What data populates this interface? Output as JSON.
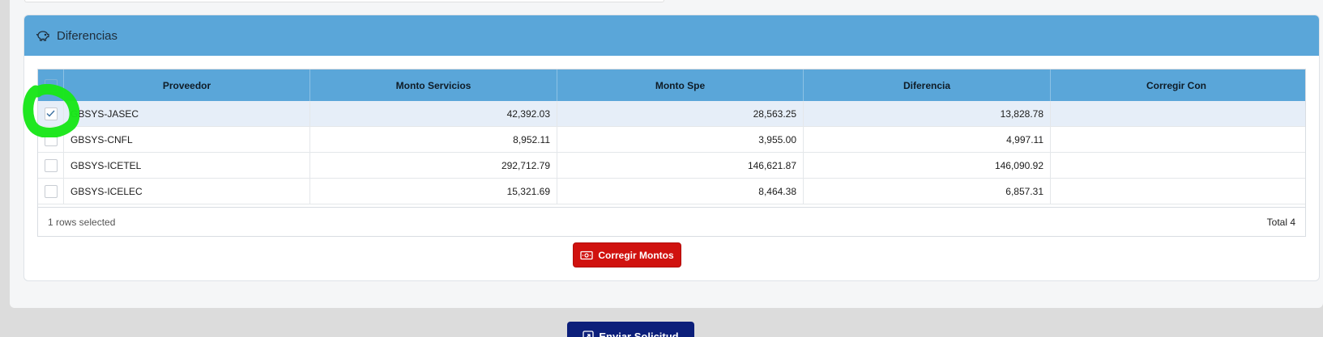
{
  "panel": {
    "title": "Diferencias",
    "title_icon": "piggy-bank-icon",
    "header_color": "#5aa6d9"
  },
  "table": {
    "columns": [
      "Proveedor",
      "Monto Servicios",
      "Monto Spe",
      "Diferencia",
      "Corregir Con"
    ],
    "rows": [
      {
        "proveedor": "GBSYS-JASEC",
        "monto_servicios": "42,392.03",
        "monto_spe": "28,563.25",
        "diferencia": "13,828.78",
        "corregir_con": "",
        "selected": true
      },
      {
        "proveedor": "GBSYS-CNFL",
        "monto_servicios": "8,952.11",
        "monto_spe": "3,955.00",
        "diferencia": "4,997.11",
        "corregir_con": "",
        "selected": false
      },
      {
        "proveedor": "GBSYS-ICETEL",
        "monto_servicios": "292,712.79",
        "monto_spe": "146,621.87",
        "diferencia": "146,090.92",
        "corregir_con": "",
        "selected": false
      },
      {
        "proveedor": "GBSYS-ICELEC",
        "monto_servicios": "15,321.69",
        "monto_spe": "8,464.38",
        "diferencia": "6,857.31",
        "corregir_con": "",
        "selected": false
      }
    ],
    "selection_status": "1 rows selected",
    "total_label": "Total 4"
  },
  "buttons": {
    "corregir_montos": "Corregir Montos",
    "corregir_icon": "cash-icon",
    "enviar_solicitud": "Enviar Solicitud",
    "enviar_icon": "send-icon"
  },
  "colors": {
    "accent_blue": "#5aa6d9",
    "danger_red": "#d0120f",
    "navy": "#0c1f7a",
    "highlight_green": "#19e619"
  }
}
